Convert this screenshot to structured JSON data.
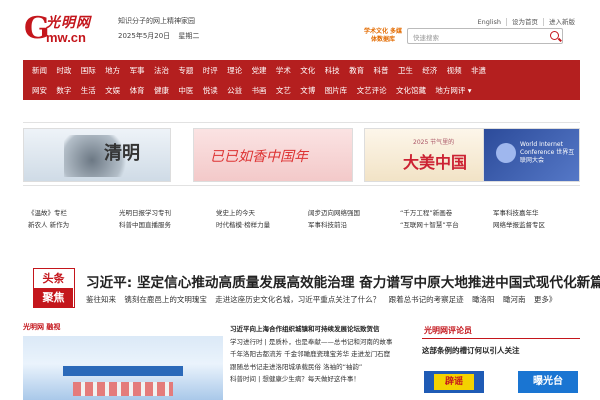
{
  "header": {
    "logo": {
      "g": "G",
      "top": "光明网",
      "bottom": "mw.cn"
    },
    "tagline": "知识分子的网上精神家园",
    "date": "2025年5月20日",
    "weekday": "星期二",
    "top_links": [
      "English",
      "设为首页",
      "进入新版"
    ],
    "promo": "学术文化 多媒体数据库",
    "search": {
      "placeholder": "快速搜索"
    }
  },
  "nav": {
    "row1": [
      "新闻",
      "时政",
      "国际",
      "地方",
      "军事",
      "法治",
      "专题",
      "时评",
      "理论",
      "党建",
      "学术",
      "文化",
      "科技",
      "教育",
      "科普",
      "卫生",
      "经济",
      "视频",
      "非遗"
    ],
    "row2": [
      "网安",
      "数字",
      "生活",
      "文娱",
      "体育",
      "健康",
      "中医",
      "悦读",
      "公益",
      "书画",
      "文艺",
      "文博",
      "图片库",
      "文艺评论",
      "文化馆藏",
      "地方网评 ▾"
    ]
  },
  "carousel": {
    "c1": "清明",
    "c2": "已已如香中国年",
    "c3_small": "2025 节气里的",
    "c3": "大美中国",
    "c4": "World Internet Conference 世界互联网大会"
  },
  "links": {
    "row1": [
      "《温故》专栏",
      "光明日报学习专刊",
      "党史上的今天",
      "阔步迈向网络强国",
      "“千万工程”新画卷",
      "军事科技嘉年华"
    ],
    "row2": [
      "新农人 新作为",
      "科普中国直播服务",
      "时代楷模·榜样力量",
      "军事科技前沿",
      "“互联网＋智慧”平台",
      "网络举报监督专区"
    ]
  },
  "headline": {
    "badge_top": "头条",
    "badge_bottom": "聚焦",
    "title": "习近平: 坚定信心推动高质量发展高效能治理 奋力谱写中原大地推进中国式现代化新篇章",
    "sub": [
      "鉴往知来",
      "镌刻在鹿邑上的文明瑰宝",
      "走进这座历史文化名城，习近平重点关注了什么？",
      "跟着总书记的考察足迹",
      "瞰洛阳",
      "瞰河南",
      "更多》"
    ]
  },
  "feature": {
    "logo": "光明网 融视",
    "items": [
      "习近平向上海合作组织城镇和可持续发展论坛致贺信",
      "学习进行时 | 是质朴，也是奉献——总书记和河南的故事",
      "千年洛阳古都流芳 千金邻瞰鹿瓷瑰宝芳华 走进龙门石窟",
      "跟随总书记走进洛阳城承载民俗 洛袖的“袖韵”",
      "科普时间 | 想健康少生病？每天做好这件事！"
    ]
  },
  "side": {
    "logo": "光明网评论员",
    "line": "这部条例的槽订何以引人关注",
    "btn_a": "辟谣",
    "btn_b": "曝光台"
  }
}
